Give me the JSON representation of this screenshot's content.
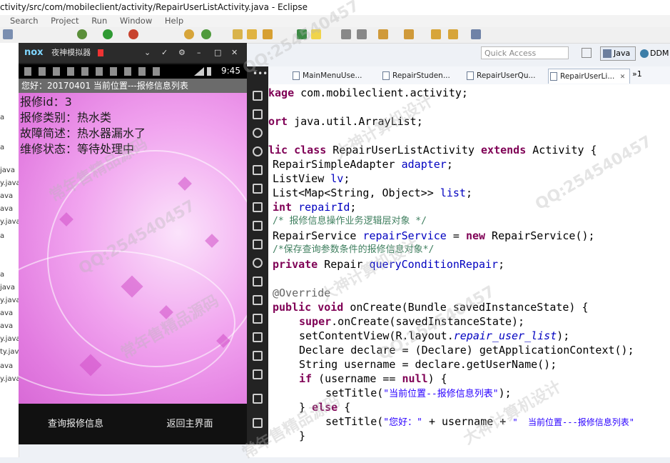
{
  "window": {
    "title": "ctivity/src/com/mobileclient/activity/RepairUserListActivity.java - Eclipse"
  },
  "menu": [
    "Search",
    "Project",
    "Run",
    "Window",
    "Help"
  ],
  "quick_access": {
    "placeholder": "Quick Access"
  },
  "perspectives": {
    "java": "Java",
    "ddms": "DDM"
  },
  "left_panel": {
    "items": [
      "a",
      "a",
      "java",
      "y.java",
      "ava",
      "ava",
      "y.java",
      "a",
      "a",
      "java",
      "y.java",
      "ava",
      "ava",
      "y.java",
      "ty.java",
      "ava",
      "y.java"
    ]
  },
  "editor_tabs": [
    {
      "label": "MainMenuUse..."
    },
    {
      "label": "RepairStuden..."
    },
    {
      "label": "RepairUserQu..."
    },
    {
      "label": "RepairUserLi...",
      "close": "✕"
    }
  ],
  "editor_overflow": "»1",
  "code": {
    "line1_kw": "kage",
    "line1_rest": " com.mobileclient.activity;",
    "line2_kw": "ort",
    "line2_rest": " java.util.ArrayList;",
    "line3_kw1": "lic",
    "line3_kw2": "class",
    "line3_name": " RepairUserListActivity ",
    "line3_kw3": "extends",
    "line3_rest": " Activity {",
    "line4_type": "RepairSimpleAdapter ",
    "line4_field": "adapter",
    "line4_end": ";",
    "line5_type": "ListView ",
    "line5_field": "lv",
    "line5_end": ";",
    "line6_type": "List<Map<String, Object>> ",
    "line6_field": "list",
    "line6_end": ";",
    "line7_kw": "int",
    "line7_field": " repairId",
    "line7_end": ";",
    "line8_comment": "/* 报修信息操作业务逻辑层对象 */",
    "line9_type": "RepairService ",
    "line9_field": "repairService",
    "line9_mid": " = ",
    "line9_kw": "new",
    "line9_rest": " RepairService();",
    "line10_comment": "/*保存查询参数条件的报修信息对象*/",
    "line11_kw": "private",
    "line11_type": " Repair ",
    "line11_field": "queryConditionRepair",
    "line11_end": ";",
    "line12_ann": "@Override",
    "line13_kw1": "public",
    "line13_kw2": "void",
    "line13_rest": " onCreate(Bundle savedInstanceState) {",
    "line14_kw": "super",
    "line14_rest": ".onCreate(savedInstanceState);",
    "line15_a": "setContentView(R.layout.",
    "line15_it": "repair_user_list",
    "line15_b": ");",
    "line16": "Declare declare = (Declare) getApplicationContext();",
    "line17": "String username = declare.getUserName();",
    "line18_kw": "if",
    "line18_a": " (username == ",
    "line18_kw2": "null",
    "line18_b": ") {",
    "line19_a": "setTitle(",
    "line19_str": "\"当前位置--报修信息列表\"",
    "line19_b": ");",
    "line20_a": "} ",
    "line20_kw": "else",
    "line20_b": " {",
    "line21_a": "setTitle(",
    "line21_str": "\"您好：\"",
    "line21_b": " + username + ",
    "line21_str2": "\"  当前位置---报修信息列表\"",
    "line22": "}"
  },
  "emulator": {
    "logo": "nox",
    "title": "夜神模拟器",
    "time": "9:45",
    "app_title": "您好：20170401  当前位置---报修信息列表",
    "fields": [
      "报修id：3",
      "报修类别：热水类",
      "故障简述：热水器漏水了",
      "维修状态：等待处理中"
    ],
    "buttons": {
      "query": "查询报修信息",
      "back": "返回主界面"
    }
  },
  "watermarks": [
    "QQ:254540457",
    "常年售精品源码",
    "大神计算机设计"
  ],
  "colors": {
    "keyword": "#7f0055",
    "field": "#0000c0",
    "comment": "#3f7f5f",
    "string": "#2a00ff",
    "emulator_bg": "#e27be0"
  }
}
